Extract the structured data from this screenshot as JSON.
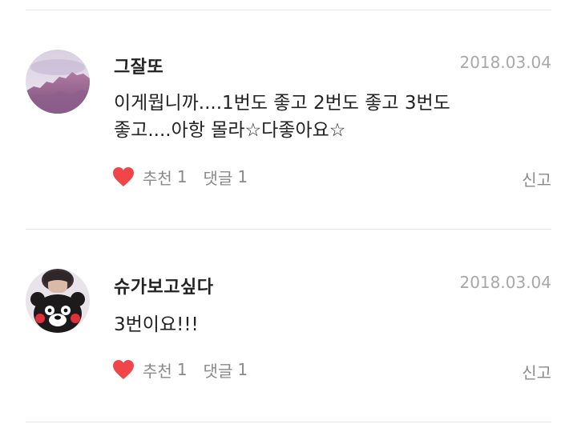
{
  "comments": [
    {
      "author": "그잘또",
      "date": "2018.03.04",
      "body_line1": "이게뭡니까....1번도 좋고 2번도 좋고 3번도",
      "body_line2": "좋고....아항 몰라☆다좋아요☆",
      "like_label": "추천",
      "like_count": "1",
      "reply_label": "댓글",
      "reply_count": "1",
      "report_label": "신고",
      "avatar": "mountain-landscape-avatar"
    },
    {
      "author": "슈가보고싶다",
      "date": "2018.03.04",
      "body_line1": "3번이요!!!",
      "like_label": "추천",
      "like_count": "1",
      "reply_label": "댓글",
      "reply_count": "1",
      "report_label": "신고",
      "avatar": "person-bear-costume-avatar"
    }
  ],
  "colors": {
    "heart": "#f0464a",
    "date": "#a8a8a8",
    "divider": "#e6e6e6"
  },
  "icons": {
    "like": "heart-icon"
  }
}
